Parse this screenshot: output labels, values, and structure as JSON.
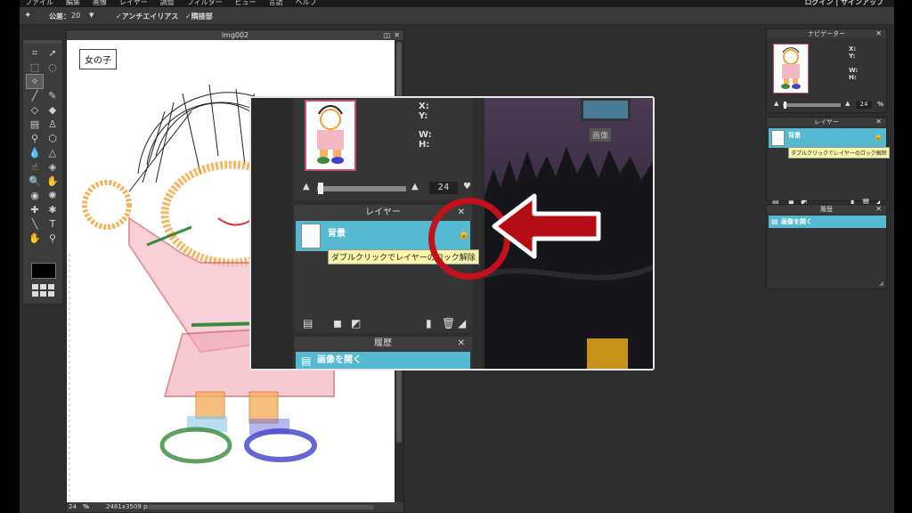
{
  "menubar": {
    "items": [
      "ファイル",
      "編集",
      "画像",
      "レイヤー",
      "調整",
      "フィルター",
      "ビュー",
      "言語",
      "ヘルプ"
    ],
    "account": "ログイン | サインアップ"
  },
  "options": {
    "tolerance_label": "公差：",
    "tolerance_value": "20",
    "dropdown_arrow": "▼",
    "antialias_label": "アンチエイリアス",
    "contiguous_label": "隣接部"
  },
  "document": {
    "title": "img002",
    "canvas_label": "女の子",
    "zoom_value": "24",
    "zoom_unit": "%",
    "dimensions": "2481x3509 px"
  },
  "navigator": {
    "title": "ナビゲーター",
    "x_label": "X:",
    "y_label": "Y:",
    "w_label": "W:",
    "h_label": "H:",
    "zoom_value": "24",
    "zoom_unit": "%"
  },
  "layers": {
    "title": "レイヤー",
    "layer_name": "背景",
    "tooltip": "ダブルクリックでレイヤーのロック解除"
  },
  "history": {
    "title": "履歴",
    "item": "画像を開く"
  },
  "inset": {
    "photo_tag": "画像"
  },
  "colors": {
    "selection": "#55b9d2",
    "tooltip_bg": "#fbf7a8",
    "callout": "#c4101a",
    "nav_border": "#c05070"
  },
  "icons": [
    "magic-wand-icon",
    "lock-icon",
    "close-icon",
    "zoom-in-icon",
    "zoom-out-icon",
    "trash-icon",
    "new-layer-icon",
    "mask-icon",
    "history-icon"
  ]
}
